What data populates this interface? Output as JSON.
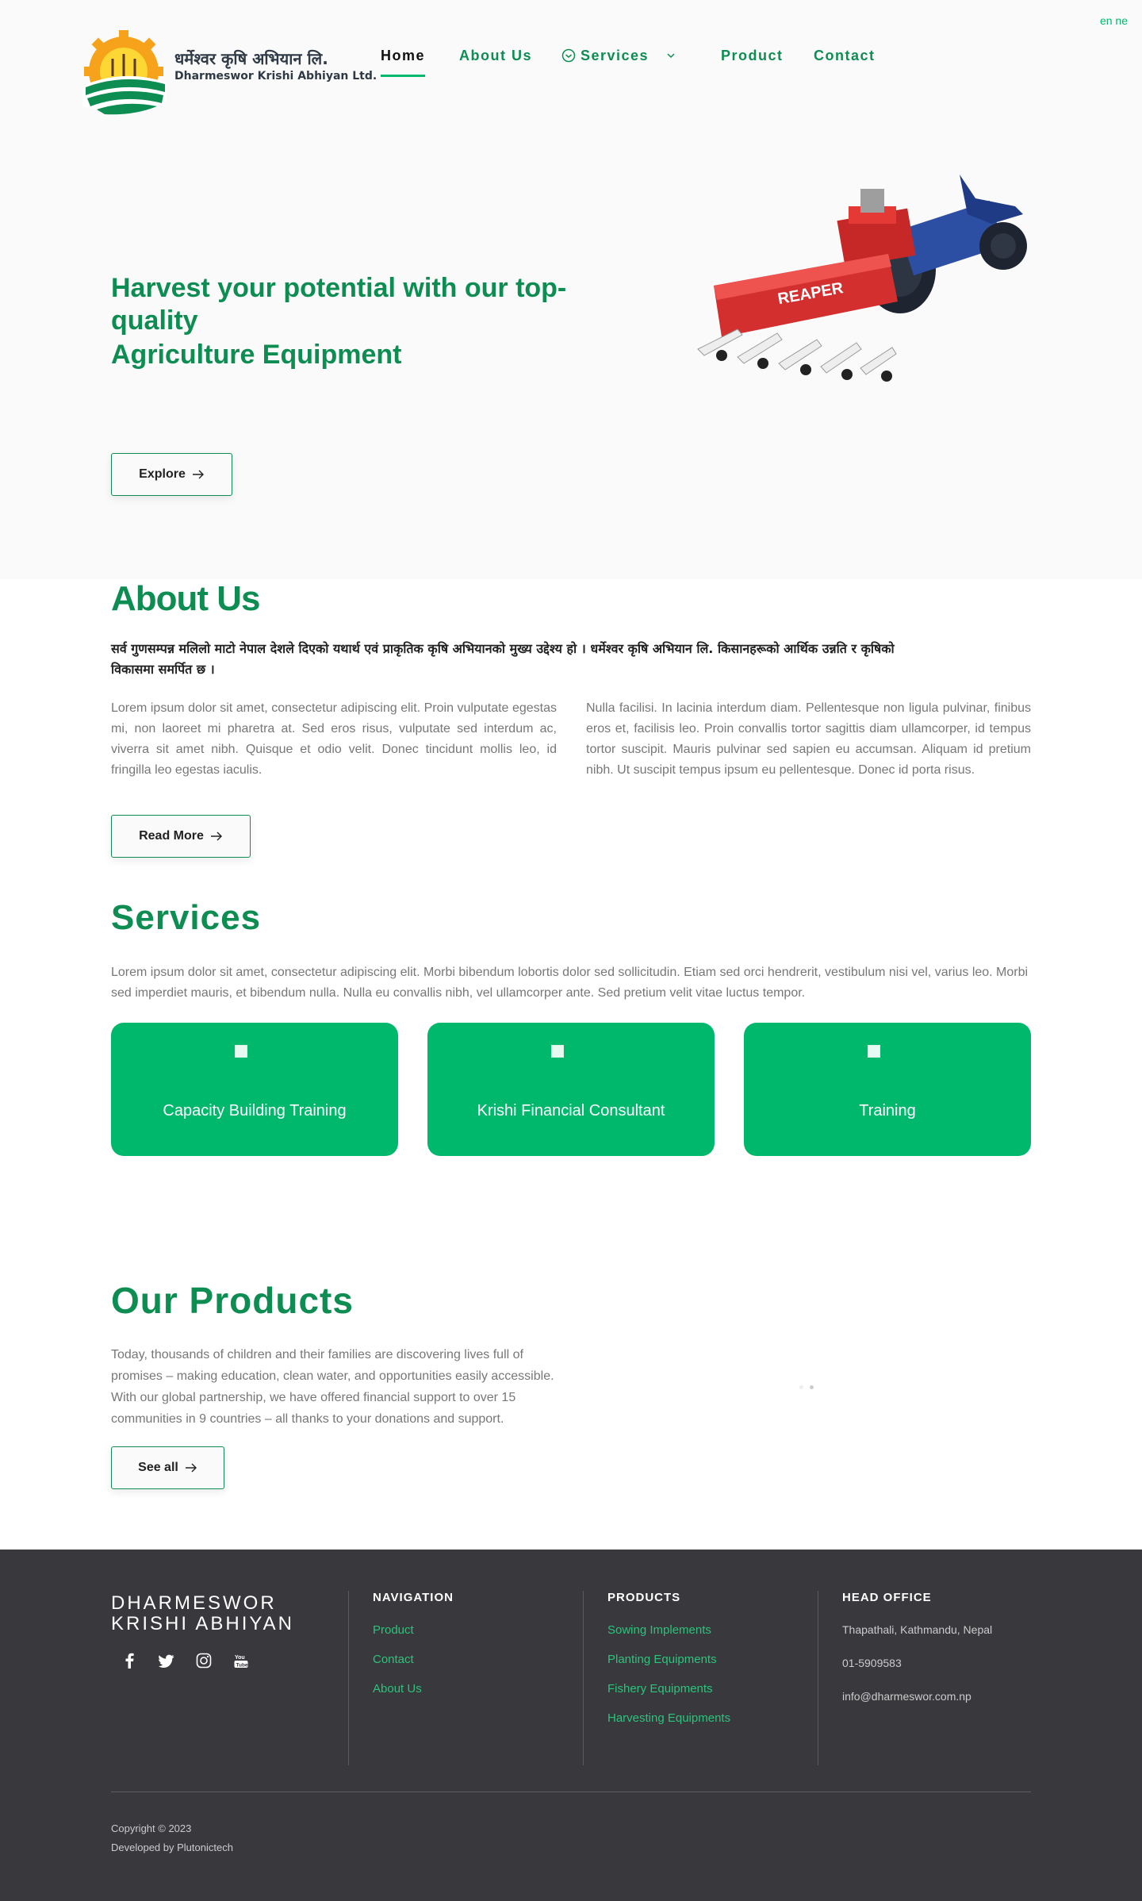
{
  "header": {
    "logo_np": "धर्मेश्वर कृषि अभियान लि.",
    "logo_en": "Dharmeswor Krishi Abhiyan Ltd.",
    "nav": [
      {
        "label": "Home"
      },
      {
        "label": "About Us"
      },
      {
        "label": "Services"
      },
      {
        "label": "Product"
      },
      {
        "label": "Contact"
      }
    ],
    "lang": "en ne"
  },
  "hero": {
    "title_line1": "Harvest your potential with our top-quality",
    "title_line2": "Agriculture Equipment",
    "button": "Explore",
    "machine_label": "REAPER"
  },
  "about": {
    "title": "About Us",
    "nepali_text": "सर्व गुणसम्पन्न मलिलो माटो नेपाल देशले दिएको यथार्थ एवं प्राकृतिक कृषि अभियानको मुख्य उद्देश्य हो । धर्मेश्वर कृषि अभियान लि. किसानहरूको आर्थिक उन्नति र कृषिको विकासमा समर्पित छ ।",
    "para_left": "Lorem ipsum dolor sit amet, consectetur adipiscing elit. Proin vulputate egestas mi, non laoreet mi pharetra at. Sed eros risus, vulputate sed interdum ac, viverra sit amet nibh. Quisque et odio velit. Donec tincidunt mollis leo, id fringilla leo egestas iaculis.",
    "para_right": "Nulla facilisi. In lacinia interdum diam. Pellentesque non ligula pulvinar, finibus eros et, facilisis leo. Proin convallis tortor sagittis diam ullamcorper, id tempus tortor suscipit. Mauris pulvinar sed sapien eu accumsan. Aliquam id pretium nibh. Ut suscipit tempus ipsum eu pellentesque. Donec id porta risus.",
    "button": "Read More"
  },
  "services": {
    "title": "Services",
    "desc": "Lorem ipsum dolor sit amet, consectetur adipiscing elit. Morbi bibendum lobortis dolor sed sollicitudin. Etiam sed orci hendrerit, vestibulum nisi vel, varius leo. Morbi sed imperdiet mauris, et bibendum nulla. Nulla eu convallis nibh, vel ullamcorper ante. Sed pretium velit vitae luctus tempor.",
    "cards": [
      {
        "label": "Capacity Building Training"
      },
      {
        "label": "Krishi Financial Consultant"
      },
      {
        "label": "Training"
      }
    ]
  },
  "products": {
    "title": "Our Products",
    "desc": "Today, thousands of children and their families are discovering lives full of promises – making education, clean water, and opportunities easily accessible. With our global partnership, we have offered financial support to over 15 communities in 9 countries – all thanks to your donations and support.",
    "button": "See all"
  },
  "footer": {
    "brand_line1": "DHARMESWOR",
    "brand_line2": "KRISHI ABHIYAN",
    "nav_head": "NAVIGATION",
    "nav_links": [
      "Product",
      "Contact",
      "About Us"
    ],
    "products_head": "PRODUCTS",
    "product_links": [
      "Sowing Implements",
      "Planting Equipments",
      "Fishery Equipments",
      "Harvesting Equipments"
    ],
    "office_head": "HEAD OFFICE",
    "address": "Thapathali, Kathmandu, Nepal",
    "phone": "01-5909583",
    "email": "info@dharmeswor.com.np",
    "copyright": "Copyright © 2023",
    "developed": "Developed by Plutonictech"
  },
  "colors": {
    "brand_green": "#0e8d52",
    "card_green": "#00b86b",
    "footer_bg": "#39383d"
  }
}
